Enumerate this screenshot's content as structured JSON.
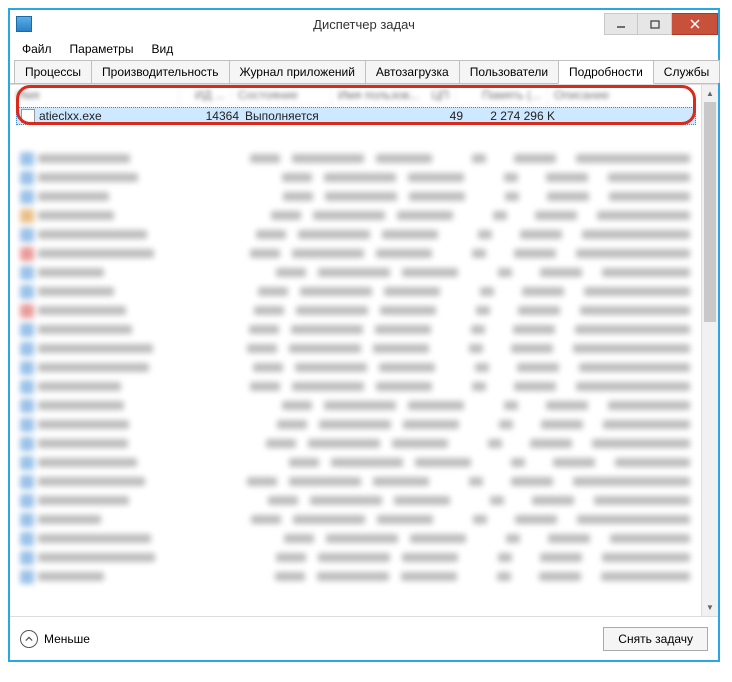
{
  "window": {
    "title": "Диспетчер задач"
  },
  "menu": {
    "file": "Файл",
    "options": "Параметры",
    "view": "Вид"
  },
  "tabs": {
    "processes": "Процессы",
    "performance": "Производительность",
    "apphistory": "Журнал приложений",
    "startup": "Автозагрузка",
    "users": "Пользователи",
    "details": "Подробности",
    "services": "Службы"
  },
  "columns": {
    "name": "Имя",
    "pid": "ИД ...",
    "status": "Состояние",
    "user": "Имя пользов...",
    "cpu": "ЦП",
    "memory": "Память (...",
    "description": "Описание"
  },
  "selected_row": {
    "name": "atieclxx.exe",
    "pid": "14364",
    "status": "Выполняется",
    "user": "",
    "cpu": "49",
    "memory": "2 274 296 K",
    "description": ""
  },
  "footer": {
    "fewer": "Меньше",
    "end_task": "Снять задачу"
  },
  "blur_colors": [
    "#4a90d9",
    "#4a90d9",
    "#4a90d9",
    "#d98b2a",
    "#4a90d9",
    "#d94a4a",
    "#4a90d9",
    "#4a90d9",
    "#d94a4a",
    "#4a90d9",
    "#4a90d9",
    "#4a90d9",
    "#4a90d9",
    "#4a90d9",
    "#4a90d9",
    "#4a90d9",
    "#4a90d9",
    "#4a90d9",
    "#4a90d9",
    "#4a90d9",
    "#4a90d9",
    "#4a90d9",
    "#4a90d9"
  ]
}
